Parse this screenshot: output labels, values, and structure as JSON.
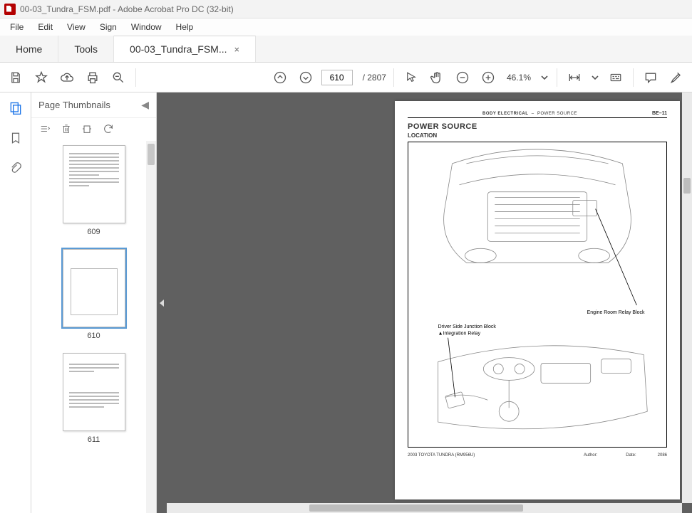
{
  "titlebar": {
    "text": "00-03_Tundra_FSM.pdf - Adobe Acrobat Pro DC (32-bit)"
  },
  "menubar": {
    "file": "File",
    "edit": "Edit",
    "view": "View",
    "sign": "Sign",
    "window": "Window",
    "help": "Help"
  },
  "tabs": {
    "home": "Home",
    "tools": "Tools",
    "doc": "00-03_Tundra_FSM..."
  },
  "toolbar": {
    "page_current": "610",
    "page_total": "/ 2807",
    "zoom": "46.1%"
  },
  "thumbnails": {
    "title": "Page Thumbnails",
    "pages": [
      "609",
      "610",
      "611"
    ]
  },
  "document": {
    "header_section": "BODY ELECTRICAL",
    "header_sub": "POWER SOURCE",
    "header_page": "BE–11",
    "title": "POWER SOURCE",
    "subtitle": "LOCATION",
    "label_engine": "Engine Room Relay Block",
    "label_junction": "Driver Side Junction Block",
    "label_relay": "Integration Relay",
    "footer_model": "2003 TOYOTA TUNDRA   (RM956U)",
    "footer_author": "Author:",
    "footer_date": "Date:",
    "footer_num": "2086"
  }
}
